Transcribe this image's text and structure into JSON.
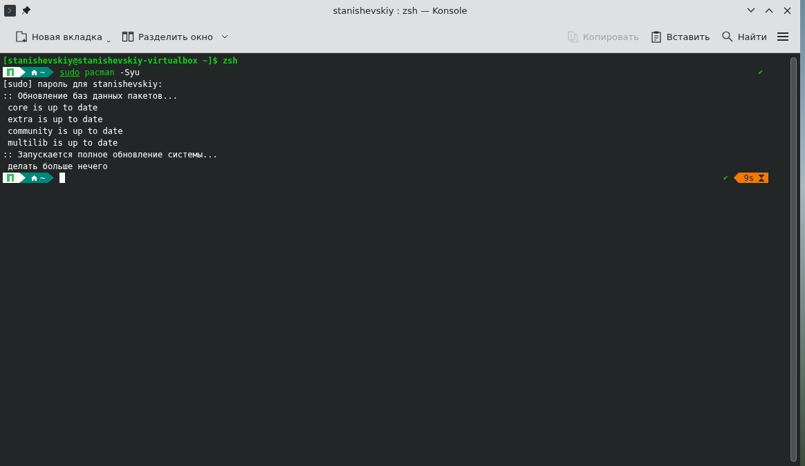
{
  "window": {
    "title": "stanishevskiy : zsh — Konsole"
  },
  "toolbar": {
    "left": [
      {
        "kind": "new-tab",
        "label": "Новая вкладка",
        "disabled": false
      },
      {
        "kind": "split",
        "label": "Разделить окно",
        "disabled": false
      }
    ],
    "right": [
      {
        "kind": "copy",
        "label": "Копировать",
        "disabled": true
      },
      {
        "kind": "paste",
        "label": "Вставить",
        "disabled": false
      },
      {
        "kind": "find",
        "label": "Найти",
        "disabled": false
      }
    ]
  },
  "terminal": {
    "lines": [
      {
        "kind": "shell",
        "text": "[stanishevskiy@stanishevskiy-virtualbox ~]$ zsh"
      },
      {
        "kind": "prompt",
        "dir": "~",
        "tokens": [
          {
            "kind": "sudo",
            "text": "sudo"
          },
          {
            "kind": "cmd",
            "text": "pacman"
          },
          {
            "kind": "arg",
            "text": "-Syu"
          }
        ],
        "status": "✔"
      },
      {
        "kind": "output",
        "text": "[sudo] пароль для stanishevskiy:"
      },
      {
        "kind": "output",
        "text": ":: Обновление баз данных пакетов..."
      },
      {
        "kind": "output",
        "text": " core is up to date"
      },
      {
        "kind": "output",
        "text": " extra is up to date"
      },
      {
        "kind": "output",
        "text": " community is up to date"
      },
      {
        "kind": "output",
        "text": " multilib is up to date"
      },
      {
        "kind": "output",
        "text": ":: Запускается полное обновление системы..."
      },
      {
        "kind": "output",
        "text": " делать больше нечего"
      },
      {
        "kind": "prompt",
        "dir": "~",
        "status": "✔",
        "duration": "9s",
        "cursor": true
      }
    ]
  }
}
